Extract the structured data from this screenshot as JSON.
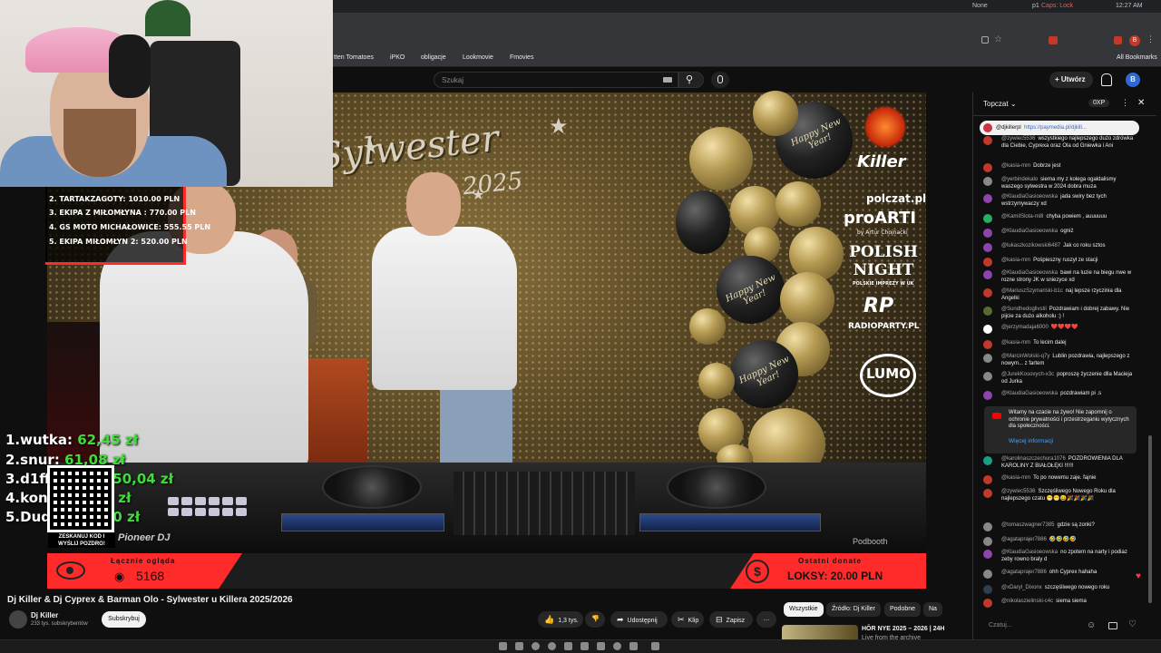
{
  "os_bar": {
    "left_items": [
      "None",
      "p1",
      "Caps: Lock",
      "12:27 AM"
    ]
  },
  "bookmarks": [
    "tten Tomatoes",
    "iPKO",
    "obligacje",
    "Lookmovie",
    "Fmovies",
    "All Bookmarks"
  ],
  "yt_header": {
    "search_placeholder": "Szukaj",
    "create_label": "Utwórz",
    "avatar_letter": "B"
  },
  "video": {
    "banner_title": "Sylwester",
    "banner_year": "2025",
    "balloon_text": "Happy New Year!",
    "sponsors": [
      "Killer",
      "polczat.pl",
      "proARTI",
      "by Artur Chojnacki",
      "POLISH NIGHT",
      "POLSKIE IMPREZY W UK",
      "RP",
      "RADIOPARTY.PL",
      "LUMO"
    ],
    "deck_brand": "Pioneer DJ",
    "podbooth": "Podbooth",
    "views_label": "Łącznie ogląda",
    "views_count": "5168",
    "donate_label": "Ostatni donate",
    "donate_value": "LOKSY: 20.00 PLN",
    "leaderboard": [
      "2. TARTAKZAGOTY: 1010.00 PLN",
      "3. EKIPA Z MIŁOMŁYNA : 770.00 PLN",
      "4. GS MOTO MICHAŁOWICE: 555.55 PLN",
      "5. EKIPA MIŁOMŁYN 2: 520.00 PLN"
    ],
    "donors": [
      {
        "name": "1.wutka:",
        "amount": "62,45 zł"
      },
      {
        "name": "2.snur:",
        "amount": "61,08 zł"
      },
      {
        "name": "3.d1ffer",
        "amount": "50,04 zł"
      },
      {
        "name": "4.konsu",
        "amount": "50,00 zł"
      },
      {
        "name": "5.Dudek:",
        "amount": "20,00 zł"
      }
    ],
    "qr_caption": "ZESKANUJ KOD I WYŚLIJ POZDRO!"
  },
  "below_video": {
    "title": "Dj Killer & Dj Cyprex & Barman Olo - Sylwester u Killera 2025/2026",
    "channel_name": "Dj Killer",
    "channel_subs": "233 tys. subskrybentów",
    "subscribe_label": "Subskrybuj",
    "likes": "1,3 tys.",
    "share_label": "Udostępnij",
    "clip_label": "Klip",
    "save_label": "Zapisz",
    "chips": [
      "Wszystkie",
      "Źródło: Dj Killer",
      "Podobne",
      "Na"
    ],
    "rec_title": "HŌR NYE 2025 – 2026 | 24H",
    "rec_sub": "Live from the archive"
  },
  "chat": {
    "title": "Topczat",
    "points": "0XP",
    "pinned_author": "@djkillerpl",
    "pinned_link": "https://paymedia.pl/djkill...",
    "messages": [
      {
        "author": "@zywiec5536",
        "text": "wszystkiego najlepszego dużo zdrówka dla Ciebie, Cyprexa oraz Ola od Gniewka i Ani",
        "color": "#c0392b"
      },
      {
        "author": "@kasia-mm",
        "text": "Dobrze jest",
        "color": "#c0392b"
      },
      {
        "author": "@yerbindekalo",
        "text": "sierna my z kolega ogaldalismy waszego sylwestra w 2024 dobra muza",
        "color": "#888888"
      },
      {
        "author": "@KlaudiaGasioeowska",
        "text": "jada swiry bez tych wstrzymywaczy xd",
        "color": "#8e44ad"
      },
      {
        "author": "@KamilSlota-m8l",
        "text": "chyba powiem , auuuuuu",
        "color": "#27ae60"
      },
      {
        "author": "@KlaudiaGasioeowska",
        "text": "ogniż",
        "color": "#8e44ad"
      },
      {
        "author": "@lukaszkozikowski6487",
        "text": "Jak co roku sztos",
        "color": "#8e44ad"
      },
      {
        "author": "@kasia-mm",
        "text": "Pośpieszny ruszył ze stacji",
        "color": "#c0392b"
      },
      {
        "author": "@KlaudiaGasioeowska",
        "text": "bawi na luzie na biegu nwe w rozne strony JK w sniezyce xd",
        "color": "#8e44ad"
      },
      {
        "author": "@MariuszSzymariski-b1c",
        "text": "naj lepsze rzyczinia dla Angelki",
        "color": "#c0392b"
      },
      {
        "author": "@Sundhedoglivstil",
        "text": "Pozdrawiam i dobrej zabawy. Nie pijcie za dużo alkoholu :) !",
        "color": "#556b2f"
      },
      {
        "author": "@jerzymadaja6000",
        "text": "❤️❤️❤️❤️",
        "color": "#ffffff"
      },
      {
        "author": "@kasia-mm",
        "text": "To lecim dalej",
        "color": "#c0392b"
      },
      {
        "author": "@MarcinWolski-q7y",
        "text": "Lublin pozdrawia, najlepszego z nowym... z fartem",
        "color": "#888888"
      },
      {
        "author": "@JurekKosovych-x3c",
        "text": "poproszę życzenie dlla Macieja od Jurka",
        "color": "#888888"
      },
      {
        "author": "@KlaudiaGasioeowska",
        "text": "pozdrawiam pi .s",
        "color": "#8e44ad"
      },
      {
        "author": "@karolinaszczechura1076",
        "text": "POZDROWIENIA DLA KAROLINY Z BIAŁOŁĘKI !!!!!!",
        "color": "#16a085"
      },
      {
        "author": "@kasia-mm",
        "text": "To po nowemu zaje. fajnie",
        "color": "#c0392b"
      },
      {
        "author": "@zywiec5536",
        "text": "Szczęśliwego Nowego Roku dla najlepszego czatu 😁😁😀🎉🎉🎉🎉",
        "color": "#c0392b"
      },
      {
        "author": "@tomaszwagner7385",
        "text": "gdzie są zonki?",
        "color": "#888888"
      },
      {
        "author": "@agataprajer7886",
        "text": "🤣🤣🤣🤣",
        "color": "#888888"
      },
      {
        "author": "@KlaudiaGasioeowska",
        "text": "no zpotem na narty i podiaz zeby rowno braly d",
        "color": "#8e44ad"
      },
      {
        "author": "@agataprajer7886",
        "text": "ohh Cyprex hahaha",
        "color": "#888888"
      },
      {
        "author": "@xDaryl_Dixonx",
        "text": "szczęśliwego nowego roku",
        "color": "#2c3e50"
      },
      {
        "author": "@nikolaszielinski-c4c",
        "text": "siema siema",
        "color": "#c0392b"
      }
    ],
    "notice_text": "Witamy na czacie na żywo! Nie zapomnij o ochronie prywatności i przestrzeganiu wytycznych dla społeczności.",
    "notice_link": "Więcej informacji",
    "input_placeholder": "Czatuj..."
  }
}
